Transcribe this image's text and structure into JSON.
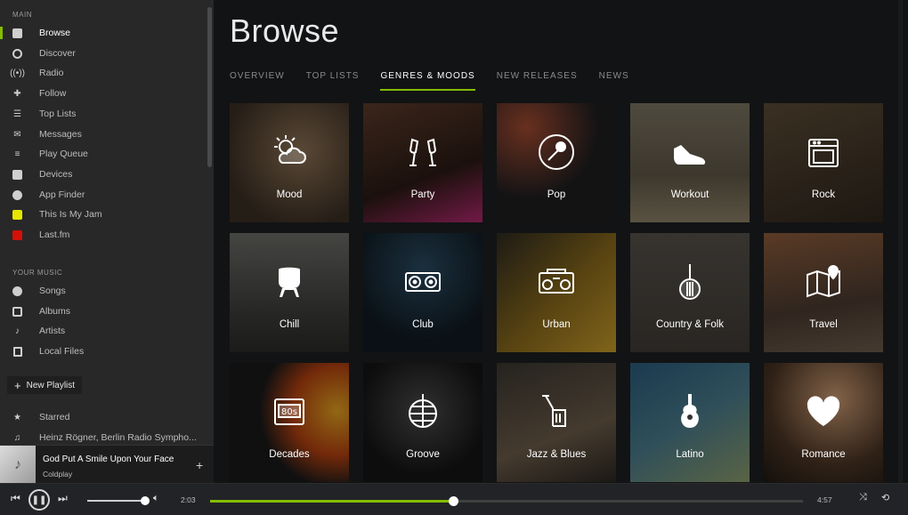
{
  "sidebar": {
    "main_section": "MAIN",
    "main_items": [
      {
        "label": "Browse",
        "icon": "browse-icon",
        "active": true
      },
      {
        "label": "Discover",
        "icon": "discover-icon"
      },
      {
        "label": "Radio",
        "icon": "radio-icon"
      },
      {
        "label": "Follow",
        "icon": "follow-icon"
      },
      {
        "label": "Top Lists",
        "icon": "top-lists-icon"
      },
      {
        "label": "Messages",
        "icon": "messages-icon"
      },
      {
        "label": "Play Queue",
        "icon": "play-queue-icon"
      },
      {
        "label": "Devices",
        "icon": "devices-icon"
      },
      {
        "label": "App Finder",
        "icon": "app-finder-icon"
      },
      {
        "label": "This Is My Jam",
        "icon": "jam-icon"
      },
      {
        "label": "Last.fm",
        "icon": "lastfm-icon"
      }
    ],
    "music_section": "YOUR MUSIC",
    "music_items": [
      {
        "label": "Songs",
        "icon": "songs-icon"
      },
      {
        "label": "Albums",
        "icon": "albums-icon"
      },
      {
        "label": "Artists",
        "icon": "artists-icon"
      },
      {
        "label": "Local Files",
        "icon": "local-files-icon"
      }
    ],
    "new_playlist": "New Playlist",
    "playlists": [
      {
        "label": "Starred",
        "icon": "star-icon"
      },
      {
        "label": "Heinz Rögner, Berlin Radio Sympho...",
        "icon": "note-icon"
      }
    ]
  },
  "now_playing": {
    "track": "God Put A Smile Upon Your Face",
    "artist": "Coldplay",
    "add_label": "+"
  },
  "main": {
    "title": "Browse",
    "tabs": [
      {
        "label": "OVERVIEW"
      },
      {
        "label": "TOP LISTS"
      },
      {
        "label": "GENRES & MOODS",
        "active": true
      },
      {
        "label": "NEW RELEASES"
      },
      {
        "label": "NEWS"
      }
    ],
    "genres": [
      {
        "label": "Mood",
        "icon": "weather-icon"
      },
      {
        "label": "Party",
        "icon": "champagne-icon"
      },
      {
        "label": "Pop",
        "icon": "microphone-icon"
      },
      {
        "label": "Workout",
        "icon": "sneaker-icon"
      },
      {
        "label": "Rock",
        "icon": "amplifier-icon"
      },
      {
        "label": "Chill",
        "icon": "armchair-icon"
      },
      {
        "label": "Club",
        "icon": "dj-deck-icon"
      },
      {
        "label": "Urban",
        "icon": "boombox-icon"
      },
      {
        "label": "Country & Folk",
        "icon": "banjo-icon"
      },
      {
        "label": "Travel",
        "icon": "map-pin-icon"
      },
      {
        "label": "Decades",
        "icon": "cassette-80s-icon"
      },
      {
        "label": "Groove",
        "icon": "disco-ball-icon"
      },
      {
        "label": "Jazz & Blues",
        "icon": "trumpet-icon"
      },
      {
        "label": "Latino",
        "icon": "guitar-icon"
      },
      {
        "label": "Romance",
        "icon": "heart-icon"
      }
    ]
  },
  "player": {
    "elapsed": "2:03",
    "duration": "4:57",
    "progress": 0.41,
    "volume": 0.95
  },
  "colors": {
    "accent": "#84bd00",
    "sidebar": "#282828",
    "background": "#121314"
  }
}
